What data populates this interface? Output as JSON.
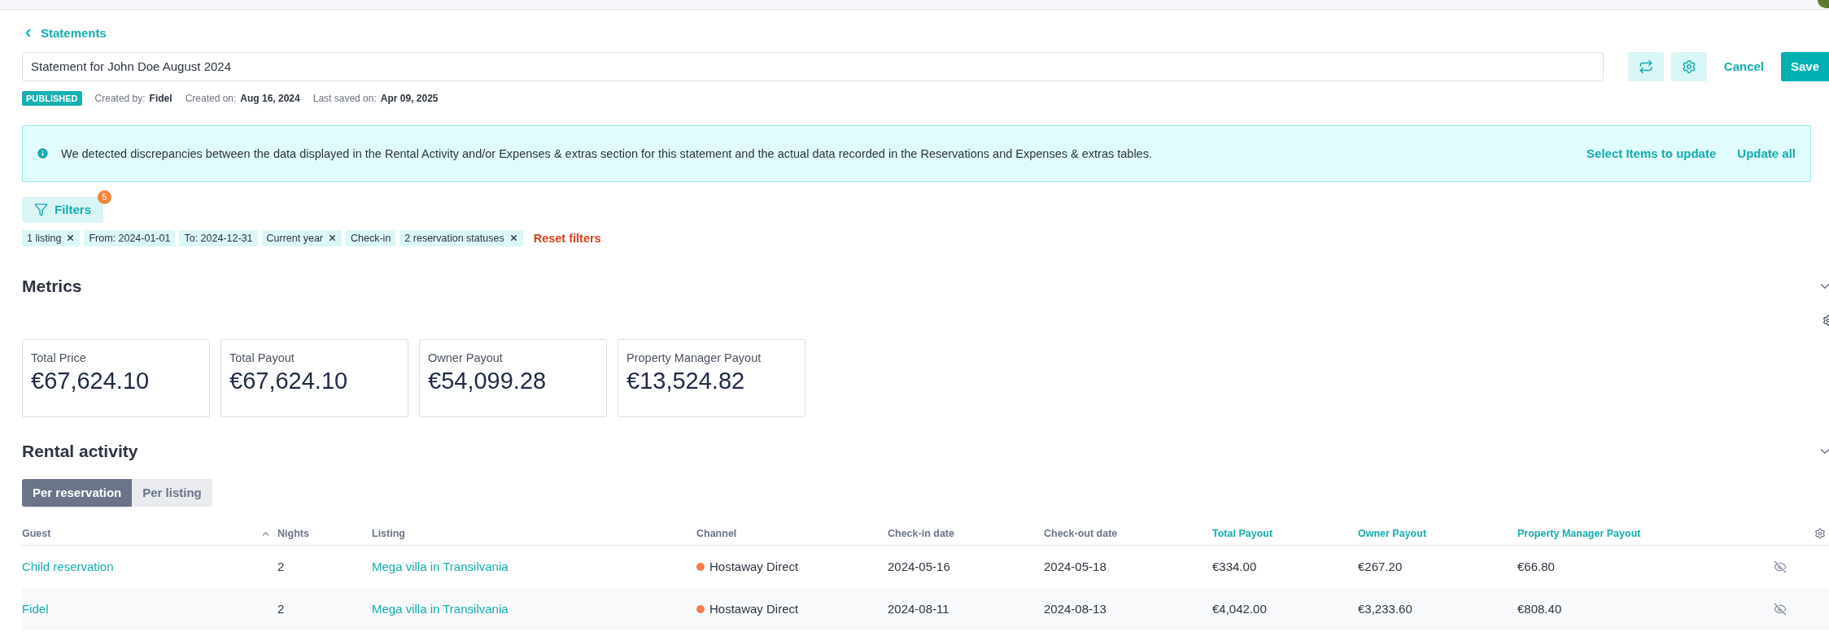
{
  "back_link": {
    "label": "Statements"
  },
  "title_field": {
    "value": "Statement for John Doe August 2024"
  },
  "actions": {
    "cancel": "Cancel",
    "save": "Save"
  },
  "meta": {
    "status": "PUBLISHED",
    "items": [
      {
        "label": "Created by:",
        "value": "Fidel"
      },
      {
        "label": "Created on:",
        "value": "Aug 16, 2024"
      },
      {
        "label": "Last saved on:",
        "value": "Apr 09, 2025"
      }
    ]
  },
  "alert": {
    "message": "We detected discrepancies between the data displayed in the Rental Activity and/or Expenses & extras section for this statement and the actual data recorded in the Reservations and Expenses & extras tables.",
    "links": [
      "Select Items to update",
      "Update all"
    ]
  },
  "filters": {
    "label": "Filters",
    "count": "5",
    "chips": [
      {
        "label": "1 listing",
        "removable": true
      },
      {
        "label": "From: 2024-01-01",
        "removable": false
      },
      {
        "label": "To: 2024-12-31",
        "removable": false
      },
      {
        "label": "Current year",
        "removable": true
      },
      {
        "label": "Check-in",
        "removable": false
      },
      {
        "label": "2 reservation statuses",
        "removable": true
      }
    ],
    "reset": "Reset filters"
  },
  "metrics": {
    "title": "Metrics",
    "expanded": true,
    "cards": [
      {
        "label": "Total Price",
        "value": "€67,624.10"
      },
      {
        "label": "Total Payout",
        "value": "€67,624.10"
      },
      {
        "label": "Owner Payout",
        "value": "€54,099.28"
      },
      {
        "label": "Property Manager Payout",
        "value": "€13,524.82"
      }
    ]
  },
  "rental_activity": {
    "title": "Rental activity",
    "expanded": true,
    "tabs": [
      {
        "label": "Per reservation",
        "selected": true
      },
      {
        "label": "Per listing",
        "selected": false
      }
    ],
    "columns": [
      {
        "label": "Guest",
        "highlighted": false,
        "sorted": true
      },
      {
        "label": "Nights",
        "highlighted": false,
        "sorted": false
      },
      {
        "label": "Listing",
        "highlighted": false,
        "sorted": false
      },
      {
        "label": "Channel",
        "highlighted": false,
        "sorted": false
      },
      {
        "label": "Check-in date",
        "highlighted": false,
        "sorted": false
      },
      {
        "label": "Check-out date",
        "highlighted": false,
        "sorted": false
      },
      {
        "label": "Total Payout",
        "highlighted": true,
        "sorted": false
      },
      {
        "label": "Owner Payout",
        "highlighted": true,
        "sorted": false
      },
      {
        "label": "Property Manager Payout",
        "highlighted": true,
        "sorted": false
      }
    ],
    "rows": [
      {
        "guest": "Child reservation",
        "nights": "2",
        "listing": "Mega villa in Transilvania",
        "channel": {
          "name": "Hostaway Direct",
          "color": "#f47d4a"
        },
        "check_in": "2024-05-16",
        "check_out": "2024-05-18",
        "total_payout": "€334.00",
        "owner_payout": "€267.20",
        "pm_payout": "€66.80",
        "hidden": true
      },
      {
        "guest": "Fidel",
        "nights": "2",
        "listing": "Mega villa in Transilvania",
        "channel": {
          "name": "Hostaway Direct",
          "color": "#f47d4a"
        },
        "check_in": "2024-08-11",
        "check_out": "2024-08-13",
        "total_payout": "€4,042.00",
        "owner_payout": "€3,233.60",
        "pm_payout": "€808.40",
        "hidden": true
      }
    ]
  }
}
